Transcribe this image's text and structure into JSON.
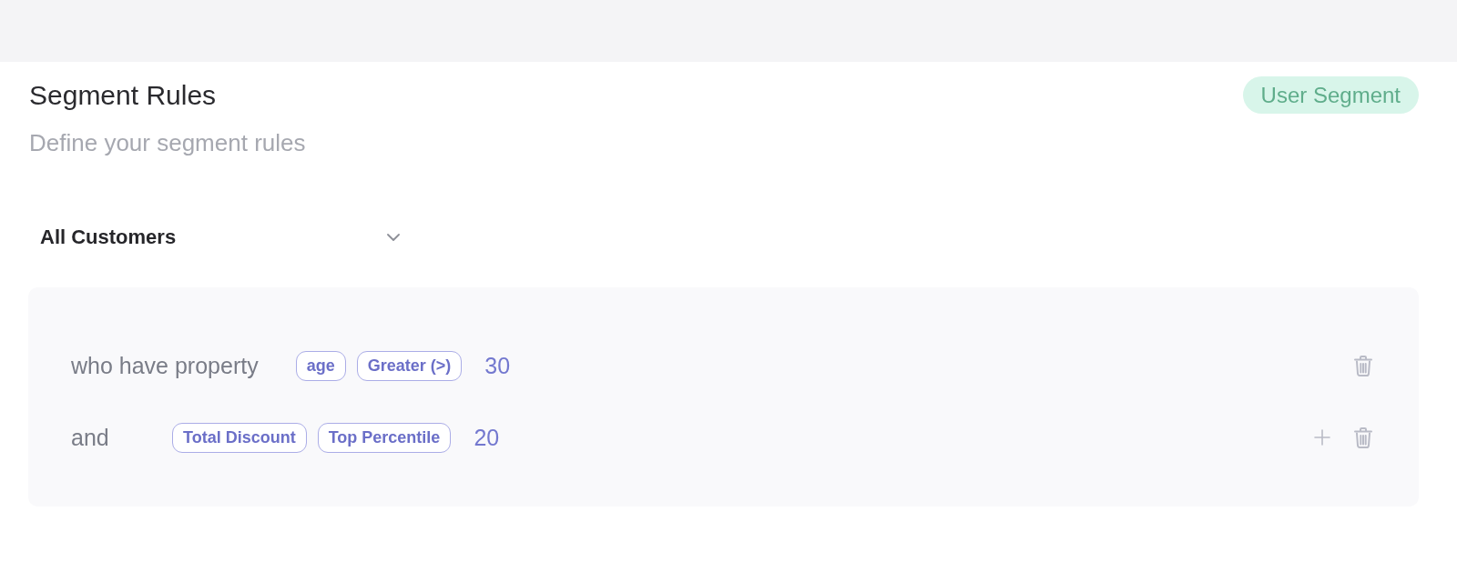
{
  "header": {
    "title": "Segment Rules",
    "subtitle": "Define your segment rules",
    "badge": "User Segment"
  },
  "audience_select": {
    "value": "All Customers"
  },
  "rules": [
    {
      "label": "who have property",
      "chips": [
        "age",
        "Greater (>)"
      ],
      "value": "30",
      "actions": [
        {
          "kind": "delete"
        }
      ]
    },
    {
      "label": "and",
      "chips": [
        "Total Discount",
        "Top Percentile"
      ],
      "value": "20",
      "actions": [
        {
          "kind": "add"
        },
        {
          "kind": "delete"
        }
      ]
    }
  ]
}
